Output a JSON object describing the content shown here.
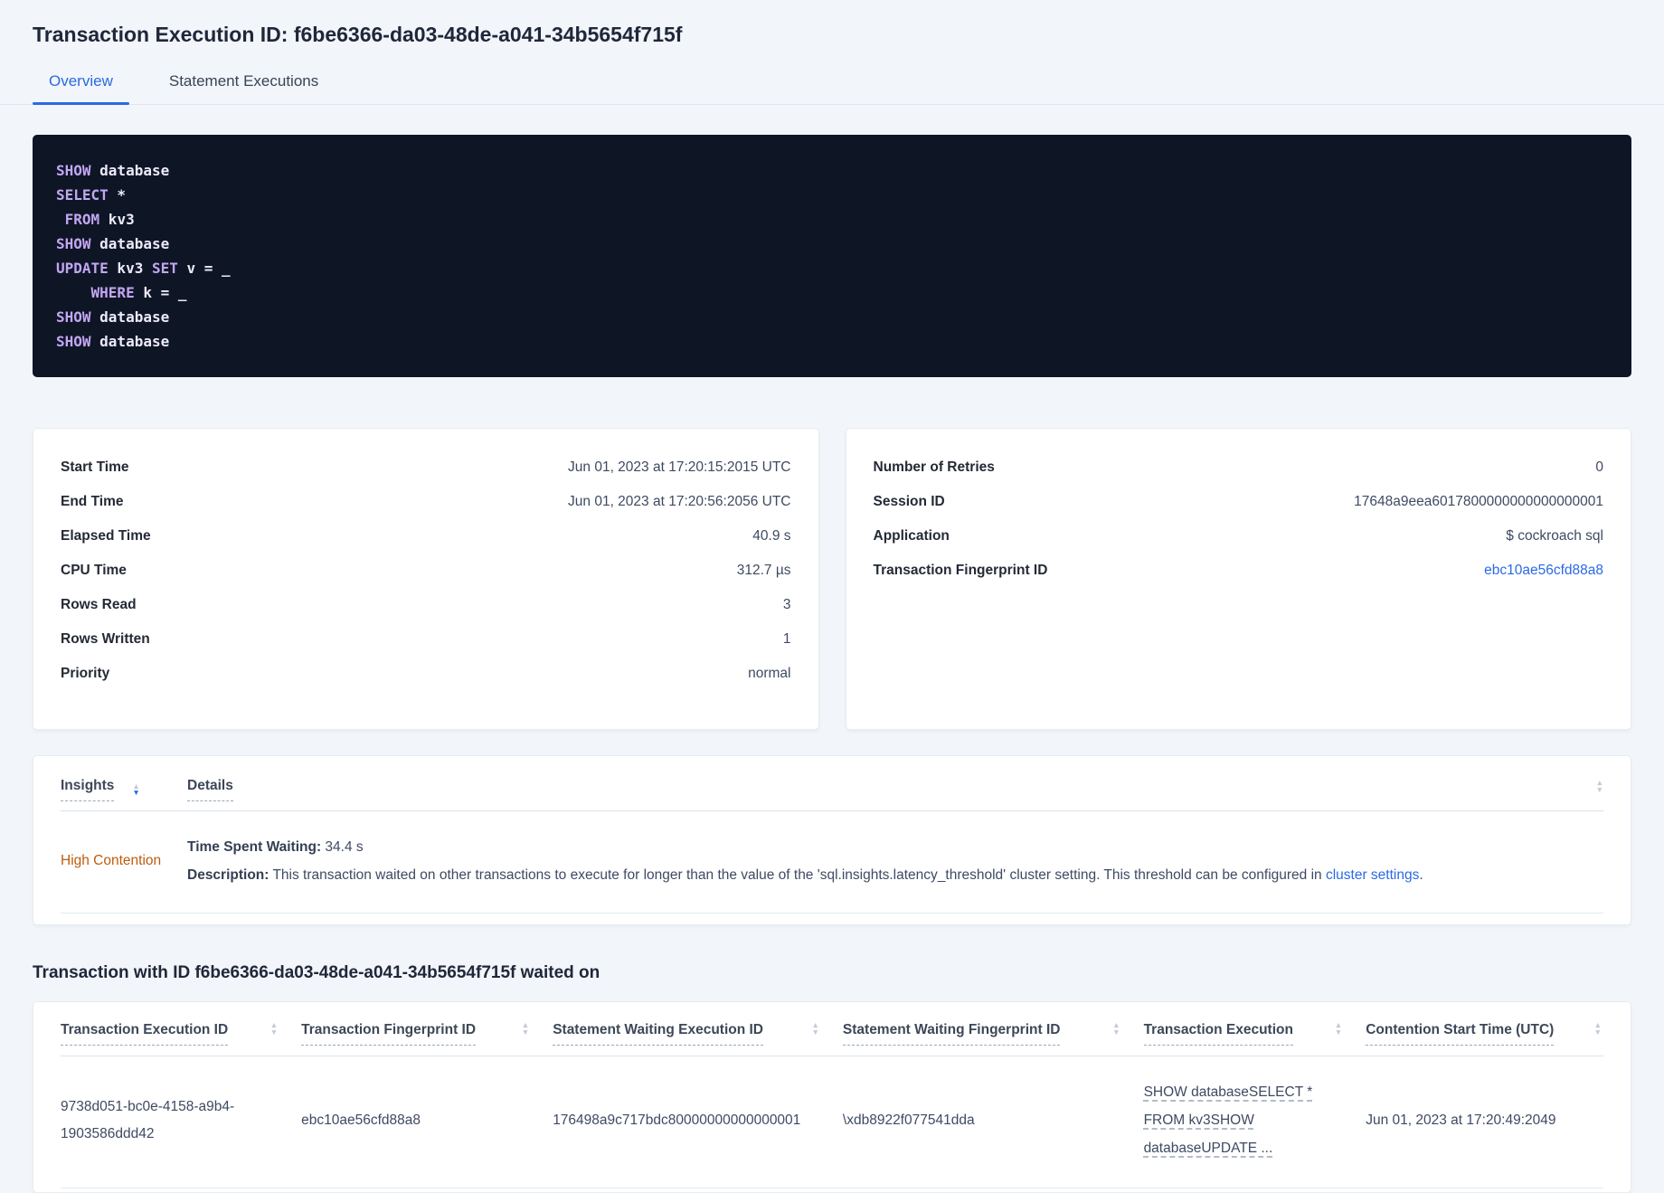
{
  "colors": {
    "accent_blue": "#2a6ae4",
    "insight_orange": "#bd5c0d",
    "code_bg": "#0e1626",
    "code_text": "#edeaf8",
    "code_keyword": "#c3a6f2"
  },
  "page": {
    "title": "Transaction Execution ID: f6be6366-da03-48de-a041-34b5654f715f"
  },
  "tabs": [
    {
      "label": "Overview",
      "active": true
    },
    {
      "label": "Statement Executions",
      "active": false
    }
  ],
  "sql_box": {
    "lines": [
      [
        {
          "t": "SHOW",
          "kw": true
        },
        {
          "t": " database"
        }
      ],
      [
        {
          "t": "SELECT",
          "kw": true
        },
        {
          "t": " *"
        }
      ],
      [
        {
          "t": " "
        },
        {
          "t": "FROM",
          "kw": true
        },
        {
          "t": " kv3"
        }
      ],
      [
        {
          "t": "SHOW",
          "kw": true
        },
        {
          "t": " database"
        }
      ],
      [
        {
          "t": "UPDATE",
          "kw": true
        },
        {
          "t": " kv3 "
        },
        {
          "t": "SET",
          "kw": true
        },
        {
          "t": " v = _"
        }
      ],
      [
        {
          "t": "    "
        },
        {
          "t": "WHERE",
          "kw": true
        },
        {
          "t": " k = _"
        }
      ],
      [
        {
          "t": "SHOW",
          "kw": true
        },
        {
          "t": " database"
        }
      ],
      [
        {
          "t": "SHOW",
          "kw": true
        },
        {
          "t": " database"
        }
      ]
    ]
  },
  "summary_left": {
    "rows": [
      {
        "label": "Start Time",
        "value": "Jun 01, 2023 at 17:20:15:2015 UTC"
      },
      {
        "label": "End Time",
        "value": "Jun 01, 2023 at 17:20:56:2056 UTC"
      },
      {
        "label": "Elapsed Time",
        "value": "40.9 s"
      },
      {
        "label": "CPU Time",
        "value": "312.7 µs"
      },
      {
        "label": "Rows Read",
        "value": "3"
      },
      {
        "label": "Rows Written",
        "value": "1"
      },
      {
        "label": "Priority",
        "value": "normal"
      }
    ]
  },
  "summary_right": {
    "rows": [
      {
        "label": "Number of Retries",
        "value": "0"
      },
      {
        "label": "Session ID",
        "value": "17648a9eea6017800000000000000001"
      },
      {
        "label": "Application",
        "value": "$ cockroach sql"
      },
      {
        "label": "Transaction Fingerprint ID",
        "value": "ebc10ae56cfd88a8",
        "link": true
      }
    ]
  },
  "insights_table": {
    "columns": [
      {
        "label": "Insights",
        "sort": "desc"
      },
      {
        "label": "Details",
        "sort": null
      }
    ],
    "rows": [
      {
        "insight": "High Contention",
        "waiting_label": "Time Spent Waiting:",
        "waiting_value": " 34.4 s",
        "description_label": "Description:",
        "description_text": " This transaction waited on other transactions to execute for longer than the value of the 'sql.insights.latency_threshold' cluster setting. This threshold can be configured in ",
        "description_link": "cluster settings",
        "description_suffix": "."
      }
    ]
  },
  "waited_on": {
    "heading": "Transaction with ID f6be6366-da03-48de-a041-34b5654f715f waited on",
    "columns": [
      "Transaction Execution ID",
      "Transaction Fingerprint ID",
      "Statement Waiting Execution ID",
      "Statement Waiting Fingerprint ID",
      "Transaction Execution",
      "Contention Start Time (UTC)"
    ],
    "rows": [
      {
        "transaction_execution_id": "9738d051-bc0e-4158-a9b4-1903586ddd42",
        "transaction_fingerprint_id": "ebc10ae56cfd88a8",
        "statement_waiting_execution_id": "176498a9c717bdc80000000000000001",
        "statement_waiting_fingerprint_id": "\\xdb8922f077541dda",
        "transaction_execution": "SHOW databaseSELECT * FROM kv3SHOW databaseUPDATE ...",
        "contention_start_time": "Jun 01, 2023 at 17:20:49:2049"
      }
    ]
  }
}
